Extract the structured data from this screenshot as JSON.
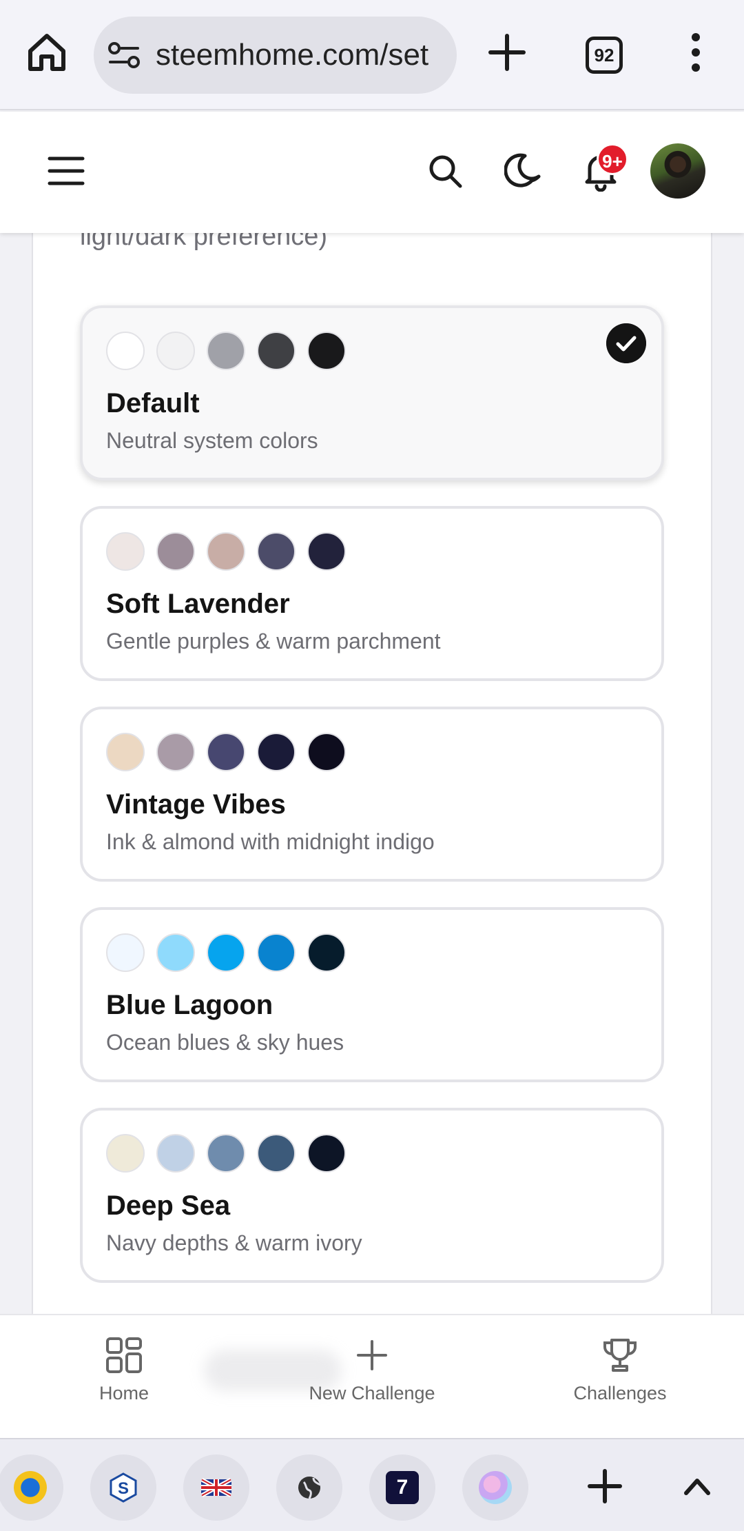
{
  "browser": {
    "url": "steemhome.com/set",
    "tab_count": "92",
    "icons": [
      "home-icon",
      "site-settings-icon",
      "new-tab-plus-icon",
      "tab-switcher-icon",
      "more-vert-icon"
    ]
  },
  "header": {
    "notification_badge": "9+",
    "icons": [
      "menu-icon",
      "search-icon",
      "moon-icon",
      "bell-icon"
    ]
  },
  "settings": {
    "intro_text": "light/dark preference)",
    "themes": [
      {
        "name": "Default",
        "desc": "Neutral system colors",
        "selected": true,
        "swatches": [
          "#ffffff",
          "#f2f2f3",
          "#a0a1a8",
          "#3f4044",
          "#19191b"
        ]
      },
      {
        "name": "Soft Lavender",
        "desc": "Gentle purples & warm parchment",
        "selected": false,
        "swatches": [
          "#eee6e4",
          "#9c8d99",
          "#c8ada6",
          "#4c4c69",
          "#22223b"
        ]
      },
      {
        "name": "Vintage Vibes",
        "desc": "Ink & almond with midnight indigo",
        "selected": false,
        "swatches": [
          "#ecd8c2",
          "#a99ba7",
          "#474770",
          "#1a1b38",
          "#0e0d1e"
        ]
      },
      {
        "name": "Blue Lagoon",
        "desc": "Ocean blues & sky hues",
        "selected": false,
        "swatches": [
          "#f0f7ff",
          "#8fdafc",
          "#06a4ee",
          "#0983cf",
          "#061c2c"
        ]
      },
      {
        "name": "Deep Sea",
        "desc": "Navy depths & warm ivory",
        "selected": false,
        "swatches": [
          "#efead9",
          "#c0d1e6",
          "#6f8cad",
          "#3c5a7a",
          "#0d1526"
        ]
      }
    ]
  },
  "bottom_nav": {
    "items": [
      {
        "label": "Home",
        "icon": "grid-icon"
      },
      {
        "label": "New Challenge",
        "icon": "plus-icon"
      },
      {
        "label": "Challenges",
        "icon": "trophy-icon"
      }
    ]
  },
  "tab_strip": {
    "tabs": [
      "steem-logo-icon",
      "steemit-s-icon",
      "uk-flag-icon",
      "globe-icon",
      "seven-app-icon",
      "anime-avatar-icon"
    ],
    "calendar_text": "7"
  },
  "colors": {
    "accent_dark": "#141414",
    "badge_red": "#e21d2b"
  }
}
